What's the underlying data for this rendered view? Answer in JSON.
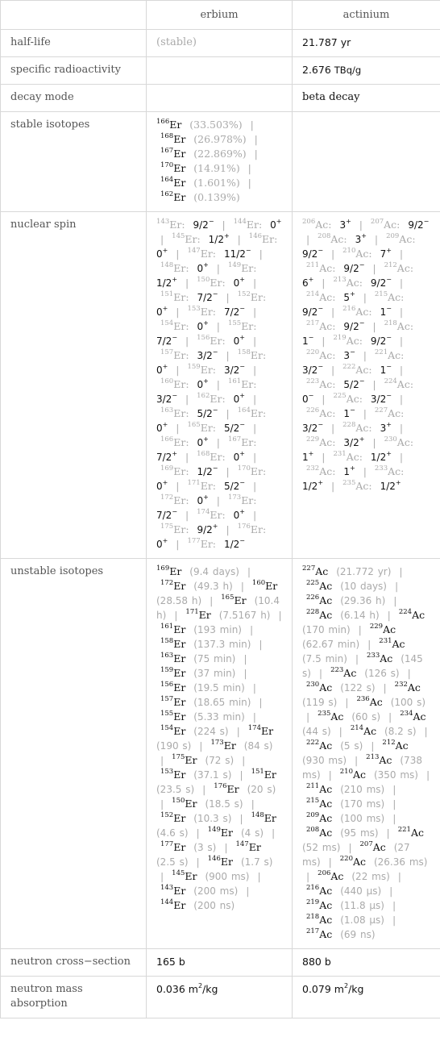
{
  "table": {
    "columns": [
      "",
      "erbium",
      "actinium"
    ],
    "rows": {
      "half_life": {
        "label": "half-life",
        "erbium": "(stable)",
        "actinium_num": "21.787",
        "actinium_unit": "yr"
      },
      "specific_radioactivity": {
        "label": "specific radioactivity",
        "erbium": "",
        "actinium_num": "2.676",
        "actinium_unit": "TBq/g"
      },
      "decay_mode": {
        "label": "decay mode",
        "erbium": "",
        "actinium": "beta decay"
      },
      "stable_isotopes": {
        "label": "stable isotopes",
        "erbium": [
          {
            "mass": "166",
            "symbol": "Er",
            "abundance": "(33.503%)"
          },
          {
            "mass": "168",
            "symbol": "Er",
            "abundance": "(26.978%)"
          },
          {
            "mass": "167",
            "symbol": "Er",
            "abundance": "(22.869%)"
          },
          {
            "mass": "170",
            "symbol": "Er",
            "abundance": "(14.91%)"
          },
          {
            "mass": "164",
            "symbol": "Er",
            "abundance": "(1.601%)"
          },
          {
            "mass": "162",
            "symbol": "Er",
            "abundance": "(0.139%)"
          }
        ],
        "actinium": []
      },
      "nuclear_spin": {
        "label": "nuclear spin",
        "erbium": [
          {
            "mass": "143",
            "symbol": "Er",
            "spin": "9/2",
            "parity": "−"
          },
          {
            "mass": "144",
            "symbol": "Er",
            "spin": "0",
            "parity": "+"
          },
          {
            "mass": "145",
            "symbol": "Er",
            "spin": "1/2",
            "parity": "+"
          },
          {
            "mass": "146",
            "symbol": "Er",
            "spin": "0",
            "parity": "+"
          },
          {
            "mass": "147",
            "symbol": "Er",
            "spin": "11/2",
            "parity": "−"
          },
          {
            "mass": "148",
            "symbol": "Er",
            "spin": "0",
            "parity": "+"
          },
          {
            "mass": "149",
            "symbol": "Er",
            "spin": "1/2",
            "parity": "+"
          },
          {
            "mass": "150",
            "symbol": "Er",
            "spin": "0",
            "parity": "+"
          },
          {
            "mass": "151",
            "symbol": "Er",
            "spin": "7/2",
            "parity": "−"
          },
          {
            "mass": "152",
            "symbol": "Er",
            "spin": "0",
            "parity": "+"
          },
          {
            "mass": "153",
            "symbol": "Er",
            "spin": "7/2",
            "parity": "−"
          },
          {
            "mass": "154",
            "symbol": "Er",
            "spin": "0",
            "parity": "+"
          },
          {
            "mass": "155",
            "symbol": "Er",
            "spin": "7/2",
            "parity": "−"
          },
          {
            "mass": "156",
            "symbol": "Er",
            "spin": "0",
            "parity": "+"
          },
          {
            "mass": "157",
            "symbol": "Er",
            "spin": "3/2",
            "parity": "−"
          },
          {
            "mass": "158",
            "symbol": "Er",
            "spin": "0",
            "parity": "+"
          },
          {
            "mass": "159",
            "symbol": "Er",
            "spin": "3/2",
            "parity": "−"
          },
          {
            "mass": "160",
            "symbol": "Er",
            "spin": "0",
            "parity": "+"
          },
          {
            "mass": "161",
            "symbol": "Er",
            "spin": "3/2",
            "parity": "−"
          },
          {
            "mass": "162",
            "symbol": "Er",
            "spin": "0",
            "parity": "+"
          },
          {
            "mass": "163",
            "symbol": "Er",
            "spin": "5/2",
            "parity": "−"
          },
          {
            "mass": "164",
            "symbol": "Er",
            "spin": "0",
            "parity": "+"
          },
          {
            "mass": "165",
            "symbol": "Er",
            "spin": "5/2",
            "parity": "−"
          },
          {
            "mass": "166",
            "symbol": "Er",
            "spin": "0",
            "parity": "+"
          },
          {
            "mass": "167",
            "symbol": "Er",
            "spin": "7/2",
            "parity": "+"
          },
          {
            "mass": "168",
            "symbol": "Er",
            "spin": "0",
            "parity": "+"
          },
          {
            "mass": "169",
            "symbol": "Er",
            "spin": "1/2",
            "parity": "−"
          },
          {
            "mass": "170",
            "symbol": "Er",
            "spin": "0",
            "parity": "+"
          },
          {
            "mass": "171",
            "symbol": "Er",
            "spin": "5/2",
            "parity": "−"
          },
          {
            "mass": "172",
            "symbol": "Er",
            "spin": "0",
            "parity": "+"
          },
          {
            "mass": "173",
            "symbol": "Er",
            "spin": "7/2",
            "parity": "−"
          },
          {
            "mass": "174",
            "symbol": "Er",
            "spin": "0",
            "parity": "+"
          },
          {
            "mass": "175",
            "symbol": "Er",
            "spin": "9/2",
            "parity": "+"
          },
          {
            "mass": "176",
            "symbol": "Er",
            "spin": "0",
            "parity": "+"
          },
          {
            "mass": "177",
            "symbol": "Er",
            "spin": "1/2",
            "parity": "−"
          }
        ],
        "actinium": [
          {
            "mass": "206",
            "symbol": "Ac",
            "spin": "3",
            "parity": "+"
          },
          {
            "mass": "207",
            "symbol": "Ac",
            "spin": "9/2",
            "parity": "−"
          },
          {
            "mass": "208",
            "symbol": "Ac",
            "spin": "3",
            "parity": "+"
          },
          {
            "mass": "209",
            "symbol": "Ac",
            "spin": "9/2",
            "parity": "−"
          },
          {
            "mass": "210",
            "symbol": "Ac",
            "spin": "7",
            "parity": "+"
          },
          {
            "mass": "211",
            "symbol": "Ac",
            "spin": "9/2",
            "parity": "−"
          },
          {
            "mass": "212",
            "symbol": "Ac",
            "spin": "6",
            "parity": "+"
          },
          {
            "mass": "213",
            "symbol": "Ac",
            "spin": "9/2",
            "parity": "−"
          },
          {
            "mass": "214",
            "symbol": "Ac",
            "spin": "5",
            "parity": "+"
          },
          {
            "mass": "215",
            "symbol": "Ac",
            "spin": "9/2",
            "parity": "−"
          },
          {
            "mass": "216",
            "symbol": "Ac",
            "spin": "1",
            "parity": "−"
          },
          {
            "mass": "217",
            "symbol": "Ac",
            "spin": "9/2",
            "parity": "−"
          },
          {
            "mass": "218",
            "symbol": "Ac",
            "spin": "1",
            "parity": "−"
          },
          {
            "mass": "219",
            "symbol": "Ac",
            "spin": "9/2",
            "parity": "−"
          },
          {
            "mass": "220",
            "symbol": "Ac",
            "spin": "3",
            "parity": "−"
          },
          {
            "mass": "221",
            "symbol": "Ac",
            "spin": "3/2",
            "parity": "−"
          },
          {
            "mass": "222",
            "symbol": "Ac",
            "spin": "1",
            "parity": "−"
          },
          {
            "mass": "223",
            "symbol": "Ac",
            "spin": "5/2",
            "parity": "−"
          },
          {
            "mass": "224",
            "symbol": "Ac",
            "spin": "0",
            "parity": "−"
          },
          {
            "mass": "225",
            "symbol": "Ac",
            "spin": "3/2",
            "parity": "−"
          },
          {
            "mass": "226",
            "symbol": "Ac",
            "spin": "1",
            "parity": "−"
          },
          {
            "mass": "227",
            "symbol": "Ac",
            "spin": "3/2",
            "parity": "−"
          },
          {
            "mass": "228",
            "symbol": "Ac",
            "spin": "3",
            "parity": "+"
          },
          {
            "mass": "229",
            "symbol": "Ac",
            "spin": "3/2",
            "parity": "+"
          },
          {
            "mass": "230",
            "symbol": "Ac",
            "spin": "1",
            "parity": "+"
          },
          {
            "mass": "231",
            "symbol": "Ac",
            "spin": "1/2",
            "parity": "+"
          },
          {
            "mass": "232",
            "symbol": "Ac",
            "spin": "1",
            "parity": "+"
          },
          {
            "mass": "233",
            "symbol": "Ac",
            "spin": "1/2",
            "parity": "+"
          },
          {
            "mass": "235",
            "symbol": "Ac",
            "spin": "1/2",
            "parity": "+"
          }
        ]
      },
      "unstable_isotopes": {
        "label": "unstable isotopes",
        "erbium": [
          {
            "mass": "169",
            "symbol": "Er",
            "half_life": "(9.4 days)"
          },
          {
            "mass": "172",
            "symbol": "Er",
            "half_life": "(49.3 h)"
          },
          {
            "mass": "160",
            "symbol": "Er",
            "half_life": "(28.58 h)"
          },
          {
            "mass": "165",
            "symbol": "Er",
            "half_life": "(10.4 h)"
          },
          {
            "mass": "171",
            "symbol": "Er",
            "half_life": "(7.5167 h)"
          },
          {
            "mass": "161",
            "symbol": "Er",
            "half_life": "(193 min)"
          },
          {
            "mass": "158",
            "symbol": "Er",
            "half_life": "(137.3 min)"
          },
          {
            "mass": "163",
            "symbol": "Er",
            "half_life": "(75 min)"
          },
          {
            "mass": "159",
            "symbol": "Er",
            "half_life": "(37 min)"
          },
          {
            "mass": "156",
            "symbol": "Er",
            "half_life": "(19.5 min)"
          },
          {
            "mass": "157",
            "symbol": "Er",
            "half_life": "(18.65 min)"
          },
          {
            "mass": "155",
            "symbol": "Er",
            "half_life": "(5.33 min)"
          },
          {
            "mass": "154",
            "symbol": "Er",
            "half_life": "(224 s)"
          },
          {
            "mass": "174",
            "symbol": "Er",
            "half_life": "(190 s)"
          },
          {
            "mass": "173",
            "symbol": "Er",
            "half_life": "(84 s)"
          },
          {
            "mass": "175",
            "symbol": "Er",
            "half_life": "(72 s)"
          },
          {
            "mass": "153",
            "symbol": "Er",
            "half_life": "(37.1 s)"
          },
          {
            "mass": "151",
            "symbol": "Er",
            "half_life": "(23.5 s)"
          },
          {
            "mass": "176",
            "symbol": "Er",
            "half_life": "(20 s)"
          },
          {
            "mass": "150",
            "symbol": "Er",
            "half_life": "(18.5 s)"
          },
          {
            "mass": "152",
            "symbol": "Er",
            "half_life": "(10.3 s)"
          },
          {
            "mass": "148",
            "symbol": "Er",
            "half_life": "(4.6 s)"
          },
          {
            "mass": "149",
            "symbol": "Er",
            "half_life": "(4 s)"
          },
          {
            "mass": "177",
            "symbol": "Er",
            "half_life": "(3 s)"
          },
          {
            "mass": "147",
            "symbol": "Er",
            "half_life": "(2.5 s)"
          },
          {
            "mass": "146",
            "symbol": "Er",
            "half_life": "(1.7 s)"
          },
          {
            "mass": "145",
            "symbol": "Er",
            "half_life": "(900 ms)"
          },
          {
            "mass": "143",
            "symbol": "Er",
            "half_life": "(200 ms)"
          },
          {
            "mass": "144",
            "symbol": "Er",
            "half_life": "(200 ns)"
          }
        ],
        "actinium": [
          {
            "mass": "227",
            "symbol": "Ac",
            "half_life": "(21.772 yr)"
          },
          {
            "mass": "225",
            "symbol": "Ac",
            "half_life": "(10 days)"
          },
          {
            "mass": "226",
            "symbol": "Ac",
            "half_life": "(29.36 h)"
          },
          {
            "mass": "228",
            "symbol": "Ac",
            "half_life": "(6.14 h)"
          },
          {
            "mass": "224",
            "symbol": "Ac",
            "half_life": "(170 min)"
          },
          {
            "mass": "229",
            "symbol": "Ac",
            "half_life": "(62.67 min)"
          },
          {
            "mass": "231",
            "symbol": "Ac",
            "half_life": "(7.5 min)"
          },
          {
            "mass": "233",
            "symbol": "Ac",
            "half_life": "(145 s)"
          },
          {
            "mass": "223",
            "symbol": "Ac",
            "half_life": "(126 s)"
          },
          {
            "mass": "230",
            "symbol": "Ac",
            "half_life": "(122 s)"
          },
          {
            "mass": "232",
            "symbol": "Ac",
            "half_life": "(119 s)"
          },
          {
            "mass": "236",
            "symbol": "Ac",
            "half_life": "(100 s)"
          },
          {
            "mass": "235",
            "symbol": "Ac",
            "half_life": "(60 s)"
          },
          {
            "mass": "234",
            "symbol": "Ac",
            "half_life": "(44 s)"
          },
          {
            "mass": "214",
            "symbol": "Ac",
            "half_life": "(8.2 s)"
          },
          {
            "mass": "222",
            "symbol": "Ac",
            "half_life": "(5 s)"
          },
          {
            "mass": "212",
            "symbol": "Ac",
            "half_life": "(930 ms)"
          },
          {
            "mass": "213",
            "symbol": "Ac",
            "half_life": "(738 ms)"
          },
          {
            "mass": "210",
            "symbol": "Ac",
            "half_life": "(350 ms)"
          },
          {
            "mass": "211",
            "symbol": "Ac",
            "half_life": "(210 ms)"
          },
          {
            "mass": "215",
            "symbol": "Ac",
            "half_life": "(170 ms)"
          },
          {
            "mass": "209",
            "symbol": "Ac",
            "half_life": "(100 ms)"
          },
          {
            "mass": "208",
            "symbol": "Ac",
            "half_life": "(95 ms)"
          },
          {
            "mass": "221",
            "symbol": "Ac",
            "half_life": "(52 ms)"
          },
          {
            "mass": "207",
            "symbol": "Ac",
            "half_life": "(27 ms)"
          },
          {
            "mass": "220",
            "symbol": "Ac",
            "half_life": "(26.36 ms)"
          },
          {
            "mass": "206",
            "symbol": "Ac",
            "half_life": "(22 ms)"
          },
          {
            "mass": "216",
            "symbol": "Ac",
            "half_life": "(440 µs)"
          },
          {
            "mass": "219",
            "symbol": "Ac",
            "half_life": "(11.8 µs)"
          },
          {
            "mass": "218",
            "symbol": "Ac",
            "half_life": "(1.08 µs)"
          },
          {
            "mass": "217",
            "symbol": "Ac",
            "half_life": "(69 ns)"
          }
        ]
      },
      "neutron_cross_section": {
        "label": "neutron cross−section",
        "erbium": "165 b",
        "actinium": "880 b"
      },
      "neutron_mass_absorption": {
        "label": "neutron mass absorption",
        "erbium_num": "0.036",
        "actinium_num": "0.079",
        "unit_base": "m",
        "unit_exp": "2",
        "unit_rest": "/kg"
      }
    },
    "separator": "|",
    "colors": {
      "border": "#d8d8d8",
      "label_text": "#555555",
      "grey_text": "#aaaaaa",
      "value_text": "#111111"
    }
  }
}
